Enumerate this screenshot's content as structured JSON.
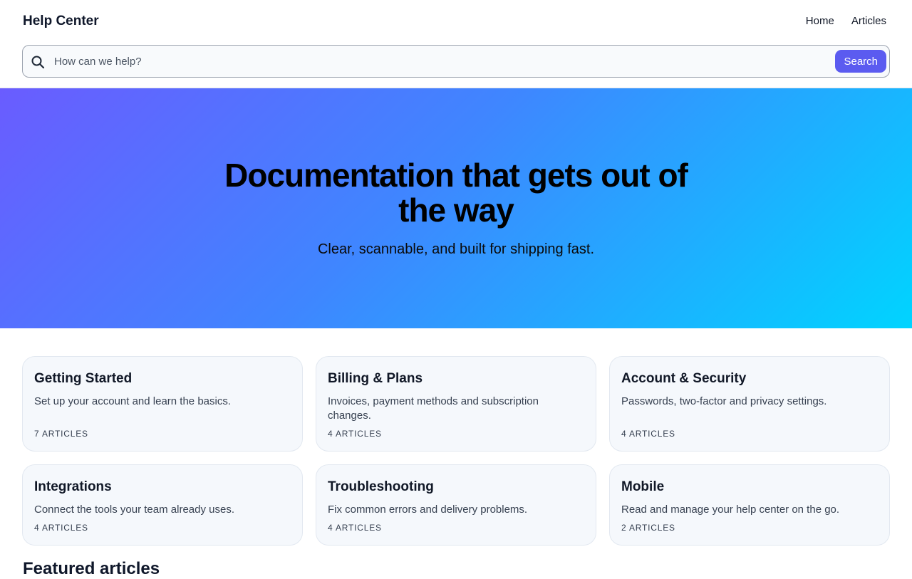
{
  "header": {
    "brand": "Help Center",
    "nav": [
      "Home",
      "Articles"
    ]
  },
  "search": {
    "placeholder": "How can we help?",
    "value": "",
    "button_label": "Search",
    "icon": "search-icon"
  },
  "hero": {
    "title": "Documentation that gets out of the way",
    "subtitle": "Clear, scannable, and built for shipping fast."
  },
  "categories": [
    {
      "title": "Getting Started",
      "description": "Set up your account and learn the basics.",
      "count": "7 ARTICLES"
    },
    {
      "title": "Billing & Plans",
      "description": "Invoices, payment methods and subscription changes.",
      "count": "4 ARTICLES"
    },
    {
      "title": "Account & Security",
      "description": "Passwords, two-factor and privacy settings.",
      "count": "4 ARTICLES"
    },
    {
      "title": "Integrations",
      "description": "Connect the tools your team already uses.",
      "count": "4 ARTICLES"
    },
    {
      "title": "Troubleshooting",
      "description": "Fix common errors and delivery problems.",
      "count": "4 ARTICLES"
    },
    {
      "title": "Mobile",
      "description": "Read and manage your help center on the go.",
      "count": "2 ARTICLES"
    }
  ],
  "featured": {
    "heading": "Featured articles"
  },
  "colors": {
    "accent": "#5b5bf0",
    "hero_start": "#6a5cff",
    "hero_end": "#00d4ff",
    "card_bg": "#f5f8fc"
  }
}
